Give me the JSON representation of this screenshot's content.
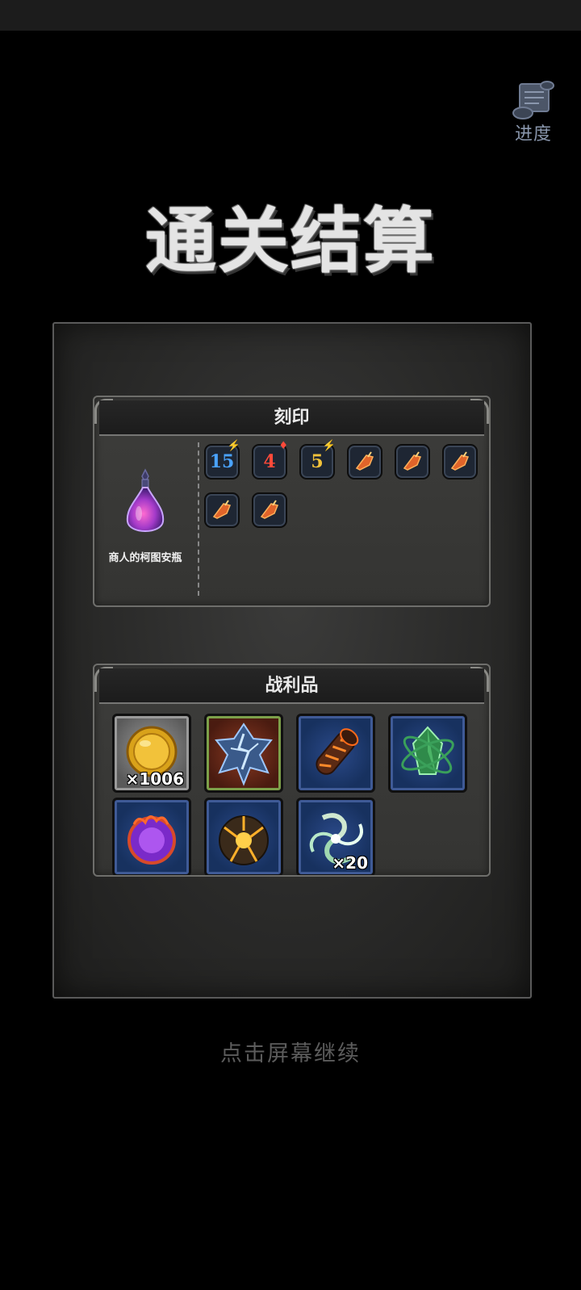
{
  "screen": {
    "title": "通关结算",
    "progress_label": "进度",
    "continue_hint": "点击屏幕继续"
  },
  "imprint": {
    "header": "刻印",
    "item_name": "商人的柯图安瓶",
    "runes": [
      {
        "value": "15",
        "badge": "lightning-icon",
        "color": "#4aa3ff"
      },
      {
        "value": "4",
        "badge": "fire-icon",
        "color": "#ff4a3a"
      },
      {
        "value": "5",
        "badge": "lightning-icon",
        "color": "#f2c23a"
      },
      {
        "value": "",
        "badge": "",
        "icon": "flame-shard-icon"
      },
      {
        "value": "",
        "badge": "",
        "icon": "flame-shard-icon"
      },
      {
        "value": "",
        "badge": "",
        "icon": "flame-shard-icon"
      },
      {
        "value": "",
        "badge": "",
        "icon": "flame-shard-icon"
      },
      {
        "value": "",
        "badge": "",
        "icon": "flame-shard-icon"
      }
    ]
  },
  "loot": {
    "header": "战利品",
    "items": [
      {
        "icon": "gold-coin-icon",
        "count": "×1006"
      },
      {
        "icon": "lightning-crystal-icon",
        "count": ""
      },
      {
        "icon": "lava-log-icon",
        "count": ""
      },
      {
        "icon": "emerald-orbit-icon",
        "count": ""
      },
      {
        "icon": "purple-flame-orb-icon",
        "count": ""
      },
      {
        "icon": "cracked-sun-stone-icon",
        "count": ""
      },
      {
        "icon": "wind-vortex-icon",
        "count": "×20"
      }
    ]
  }
}
